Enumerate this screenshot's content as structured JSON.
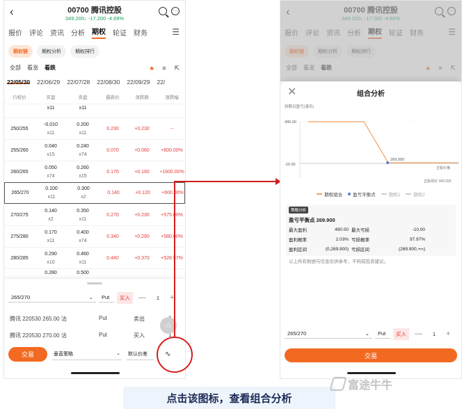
{
  "stock": {
    "code_name": "00700  腾讯控股",
    "price_line": "349.200↓ -17.200 -4.69%"
  },
  "tabs": [
    "报价",
    "评论",
    "资讯",
    "分析",
    "期权",
    "轮证",
    "财务"
  ],
  "chips": [
    "期权链",
    "期权分析",
    "期权排行"
  ],
  "filters": [
    "全部",
    "看涨",
    "看跌"
  ],
  "dates": [
    "22/05/30",
    "22/06/29",
    "22/07/28",
    "22/08/30",
    "22/09/29",
    "22/"
  ],
  "table": {
    "headers": [
      "行权价",
      "买盘",
      "卖盘",
      "最新价",
      "涨跌额",
      "涨跌幅"
    ],
    "top_partial": [
      "",
      "x11",
      "x11",
      "",
      "",
      ""
    ],
    "rows": [
      {
        "strike": "250/255",
        "bid": "-0.010",
        "bid_size": "x11",
        "ask": "0.200",
        "ask_size": "x11",
        "last": "0.230",
        "chg": "+0.230",
        "pct": "--"
      },
      {
        "strike": "255/260",
        "bid": "0.040",
        "bid_size": "x15",
        "ask": "0.240",
        "ask_size": "x74",
        "last": "0.070",
        "chg": "+0.060",
        "pct": "+600.00%"
      },
      {
        "strike": "260/265",
        "bid": "0.050",
        "bid_size": "x74",
        "ask": "0.260",
        "ask_size": "x15",
        "last": "0.170",
        "chg": "+0.160",
        "pct": "+1600.00%"
      },
      {
        "strike": "265/270",
        "bid": "0.100",
        "bid_size": "x11",
        "ask": "0.300",
        "ask_size": "x2",
        "last": "0.140",
        "chg": "+0.120",
        "pct": "+600.00%"
      },
      {
        "strike": "270/275",
        "bid": "0.140",
        "bid_size": "x2",
        "ask": "0.350",
        "ask_size": "x11",
        "last": "0.270",
        "chg": "+0.230",
        "pct": "+575.00%"
      },
      {
        "strike": "275/280",
        "bid": "0.170",
        "bid_size": "x11",
        "ask": "0.400",
        "ask_size": "x74",
        "last": "0.340",
        "chg": "+0.290",
        "pct": "+580.00%"
      },
      {
        "strike": "280/285",
        "bid": "0.290",
        "bid_size": "x10",
        "ask": "0.460",
        "ask_size": "x11",
        "last": "0.440",
        "chg": "+0.370",
        "pct": "+528.57%"
      }
    ],
    "bottom_partial": [
      "",
      "0.280",
      "0.500",
      "",
      "",
      ""
    ]
  },
  "order": {
    "strike": "265/270",
    "type": "Put",
    "side": "买入",
    "minus": "—",
    "qty": "1",
    "plus": "+"
  },
  "legs": [
    {
      "name": "腾讯 220530 265.00 沽",
      "type": "Put",
      "side": "卖出",
      "qty": "1"
    },
    {
      "name": "腾讯 220530 270.00 沽",
      "type": "Put",
      "side": "买入",
      "qty": "1"
    }
  ],
  "bottom": {
    "trade": "交易",
    "strategy": "垂直策略",
    "spread": "默认价差"
  },
  "analysis": {
    "title": "组合分析",
    "y_axis_title": "到期日盈亏(港币)",
    "y_ticks": [
      "490.00",
      "-10.00"
    ],
    "breakeven_label": "269.900",
    "x_label": "正股价格",
    "current_label": "正股现价 349.200",
    "legend": [
      "期权组合",
      "盈亏平衡点",
      "期权1",
      "期权2"
    ],
    "tag": "策略分析",
    "breakeven_title": "盈亏平衡点  269.900",
    "stats": [
      [
        "最大盈利",
        "490.00",
        "最大亏损",
        "-10.00"
      ],
      [
        "盈利概率",
        "2.03%",
        "亏损概率",
        "97.97%"
      ],
      [
        "盈利区间",
        "(0,269.900)",
        "亏损区间",
        "(269.900,+∞)"
      ]
    ],
    "disclaimer": "以上所有数据与信息仅供参考，不构成投资建议。",
    "trade": "交易"
  },
  "caption": "点击该图标，查看组合分析",
  "watermark": "富途牛牛",
  "colors": {
    "accent": "#f26a21",
    "up": "#e63b3b",
    "down": "#19a15f",
    "annotation": "#d51d1d"
  }
}
